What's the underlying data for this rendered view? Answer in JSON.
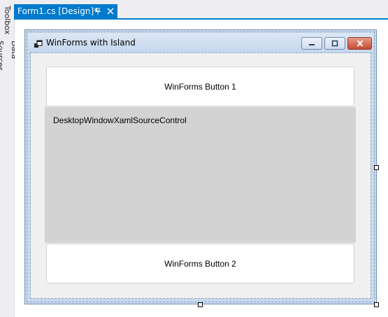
{
  "side_panel": {
    "toolbox_label": "Toolbox",
    "data_sources_label": "Data Sources"
  },
  "tab": {
    "title": "Form1.cs [Design]*",
    "pin_icon": "pin-icon",
    "close_icon": "close-icon",
    "accent_color": "#007acc"
  },
  "form": {
    "title": "WinForms with Island",
    "icon": "window-app-icon",
    "caption_buttons": [
      "minimize-icon",
      "maximize-icon",
      "close-icon"
    ]
  },
  "controls": {
    "button1_label": "WinForms Button 1",
    "xaml_host_label": "DesktopWindowXamlSourceControl",
    "button2_label": "WinForms Button 2"
  }
}
